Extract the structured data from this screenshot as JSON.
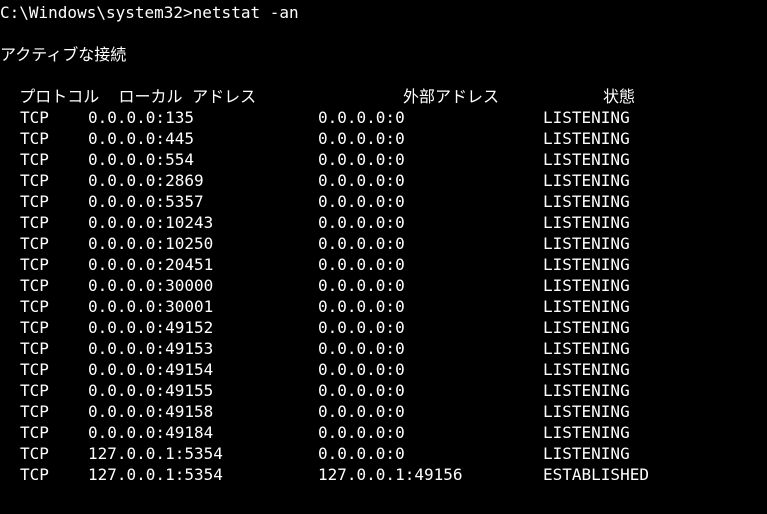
{
  "prompt": "C:\\Windows\\system32>",
  "command": "netstat -an",
  "title": "アクティブな接続",
  "headers": {
    "protocol": "  プロトコル  ローカル アドレス",
    "foreign": "外部アドレス",
    "state": "状態"
  },
  "rows": [
    {
      "proto": "TCP",
      "local": "0.0.0.0:135",
      "foreign": "0.0.0.0:0",
      "state": "LISTENING"
    },
    {
      "proto": "TCP",
      "local": "0.0.0.0:445",
      "foreign": "0.0.0.0:0",
      "state": "LISTENING"
    },
    {
      "proto": "TCP",
      "local": "0.0.0.0:554",
      "foreign": "0.0.0.0:0",
      "state": "LISTENING"
    },
    {
      "proto": "TCP",
      "local": "0.0.0.0:2869",
      "foreign": "0.0.0.0:0",
      "state": "LISTENING"
    },
    {
      "proto": "TCP",
      "local": "0.0.0.0:5357",
      "foreign": "0.0.0.0:0",
      "state": "LISTENING"
    },
    {
      "proto": "TCP",
      "local": "0.0.0.0:10243",
      "foreign": "0.0.0.0:0",
      "state": "LISTENING"
    },
    {
      "proto": "TCP",
      "local": "0.0.0.0:10250",
      "foreign": "0.0.0.0:0",
      "state": "LISTENING"
    },
    {
      "proto": "TCP",
      "local": "0.0.0.0:20451",
      "foreign": "0.0.0.0:0",
      "state": "LISTENING"
    },
    {
      "proto": "TCP",
      "local": "0.0.0.0:30000",
      "foreign": "0.0.0.0:0",
      "state": "LISTENING"
    },
    {
      "proto": "TCP",
      "local": "0.0.0.0:30001",
      "foreign": "0.0.0.0:0",
      "state": "LISTENING"
    },
    {
      "proto": "TCP",
      "local": "0.0.0.0:49152",
      "foreign": "0.0.0.0:0",
      "state": "LISTENING"
    },
    {
      "proto": "TCP",
      "local": "0.0.0.0:49153",
      "foreign": "0.0.0.0:0",
      "state": "LISTENING"
    },
    {
      "proto": "TCP",
      "local": "0.0.0.0:49154",
      "foreign": "0.0.0.0:0",
      "state": "LISTENING"
    },
    {
      "proto": "TCP",
      "local": "0.0.0.0:49155",
      "foreign": "0.0.0.0:0",
      "state": "LISTENING"
    },
    {
      "proto": "TCP",
      "local": "0.0.0.0:49158",
      "foreign": "0.0.0.0:0",
      "state": "LISTENING"
    },
    {
      "proto": "TCP",
      "local": "0.0.0.0:49184",
      "foreign": "0.0.0.0:0",
      "state": "LISTENING"
    },
    {
      "proto": "TCP",
      "local": "127.0.0.1:5354",
      "foreign": "0.0.0.0:0",
      "state": "LISTENING"
    },
    {
      "proto": "TCP",
      "local": "127.0.0.1:5354",
      "foreign": "127.0.0.1:49156",
      "state": "ESTABLISHED"
    }
  ]
}
